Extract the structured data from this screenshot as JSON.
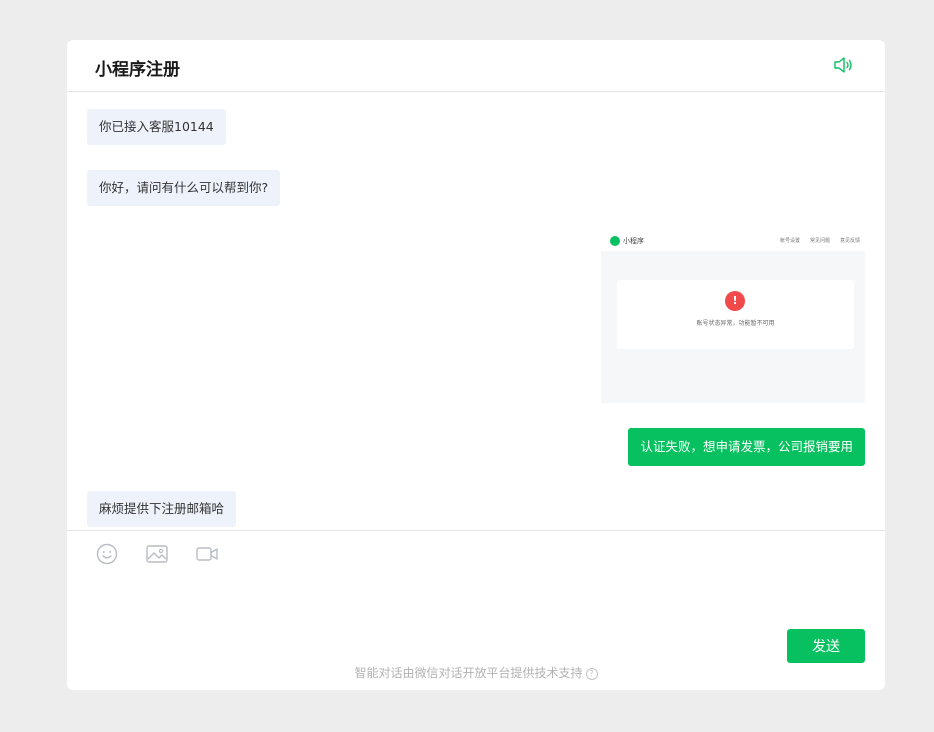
{
  "header": {
    "title": "小程序注册",
    "speaker_icon": "speaker-icon"
  },
  "messages": [
    {
      "role": "agent",
      "text": "你已接入客服10144"
    },
    {
      "role": "agent",
      "text": "你好，请问有什么可以帮到你?"
    },
    {
      "role": "user",
      "type": "image",
      "screenshot": {
        "brand": "小程序",
        "links": [
          "帐号设置",
          "常见问题",
          "意见反馈"
        ],
        "alert_icon": "!",
        "message": "账号状态异常，功能暂不可用"
      }
    },
    {
      "role": "user",
      "text": "认证失败，想申请发票，公司报销要用"
    },
    {
      "role": "agent",
      "text": "麻烦提供下注册邮箱哈"
    }
  ],
  "toolbar": {
    "icons": [
      "emoji-icon",
      "image-icon",
      "video-icon"
    ]
  },
  "input": {
    "value": ""
  },
  "send_label": "发送",
  "footer": {
    "text": "智能对话由微信对话开放平台提供技术支持",
    "help_icon": "?"
  },
  "colors": {
    "accent": "#07c160",
    "agent_bubble": "#eef3fb",
    "alert": "#f04a4a"
  }
}
